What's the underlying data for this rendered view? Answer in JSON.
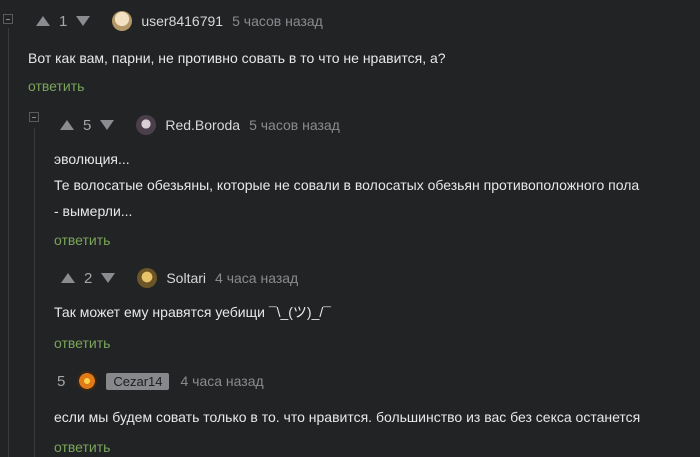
{
  "comments": [
    {
      "score": "1",
      "username": "user8416791",
      "time": "5 часов назад",
      "lines": [
        "Вот как вам, парни, не противно совать в то что не нравится, а?"
      ],
      "reply_label": "ответить"
    },
    {
      "score": "5",
      "username": "Red.Boroda",
      "time": "5 часов назад",
      "lines": [
        "эволюция...",
        "Те волосатые обезьяны, которые не совали в волосатых обезьян противоположного пола",
        "- вымерли..."
      ],
      "reply_label": "ответить"
    },
    {
      "score": "2",
      "username": "Soltari",
      "time": "4 часа назад",
      "lines": [
        "Так может ему нравятся уебищи ¯\\_(ツ)_/¯"
      ],
      "reply_label": "ответить"
    },
    {
      "score": "5",
      "username": "Cezar14",
      "time": "4 часа назад",
      "lines": [
        "если мы будем совать только в то. что нравится. большинство из вас без секса останется"
      ],
      "reply_label": "ответить"
    }
  ],
  "colors": {
    "background": "#222325",
    "reply_link": "#7aa55b",
    "badge_bg": "#87888b"
  }
}
